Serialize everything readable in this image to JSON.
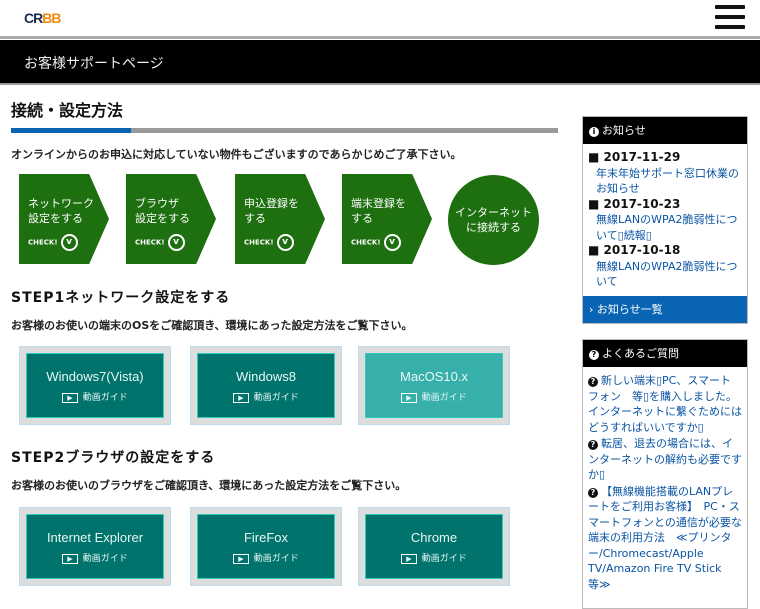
{
  "header": {
    "logo_a": "CR",
    "logo_b": "BB",
    "menu": "menu"
  },
  "banner": "お客様サポートページ",
  "title": "接続・設定方法",
  "progress": 0.22,
  "notice": "オンラインからのお申込に対応していない物件もございますのであらかじめご了承下さい。",
  "steps": [
    {
      "label1": "ネットワーク",
      "label2": "設定をする",
      "check": "CHECK!"
    },
    {
      "label1": "ブラウザ",
      "label2": "設定をする",
      "check": "CHECK!"
    },
    {
      "label1": "申込登録を",
      "label2": "する",
      "check": "CHECK!"
    },
    {
      "label1": "端末登録を",
      "label2": "する",
      "check": "CHECK!"
    }
  ],
  "goal": {
    "l1": "インターネット",
    "l2": "に接続する"
  },
  "step1": {
    "heading": "STEP1ネットワーク設定をする",
    "desc": "お客様のお使いの端末のOSをご確認頂き、環境にあった設定方法をご覧下さい。",
    "cards": [
      {
        "name": "Windows7(Vista)",
        "guide": "動画ガイド"
      },
      {
        "name": "Windows8",
        "guide": "動画ガイド"
      },
      {
        "name": "MacOS10.x",
        "guide": "動画ガイド"
      }
    ]
  },
  "step2": {
    "heading": "STEP2ブラウザの設定をする",
    "desc": "お客様のお使いのブラウザをご確認頂き、環境にあった設定方法をご覧下さい。",
    "cards": [
      {
        "name": "Internet Explorer",
        "guide": "動画ガイド"
      },
      {
        "name": "FireFox",
        "guide": "動画ガイド"
      },
      {
        "name": "Chrome",
        "guide": "動画ガイド"
      }
    ]
  },
  "news": {
    "title": "お知らせ",
    "items": [
      {
        "date": "2017-11-29",
        "text": "年末年始サポート窓口休業のお知らせ"
      },
      {
        "date": "2017-10-23",
        "text": "無線LANのWPA2脆弱性について▯続報▯"
      },
      {
        "date": "2017-10-18",
        "text": "無線LANのWPA2脆弱性について"
      }
    ],
    "more": "お知らせ一覧"
  },
  "faq": {
    "title": "よくあるご質問",
    "items": [
      "新しい端末▯PC、スマートフォン　等▯を購入しました。インターネットに繋ぐためにはどうすればいいですか▯",
      "転居、退去の場合には、インターネットの解約も必要ですか▯",
      "【無線機能搭載のLANプレートをご利用お客様】　PC・スマートフォンとの通信が必要な端末の利用方法　≪プリンター/Chromecast/Apple TV/Amazon Fire TV Stick　等≫"
    ]
  }
}
